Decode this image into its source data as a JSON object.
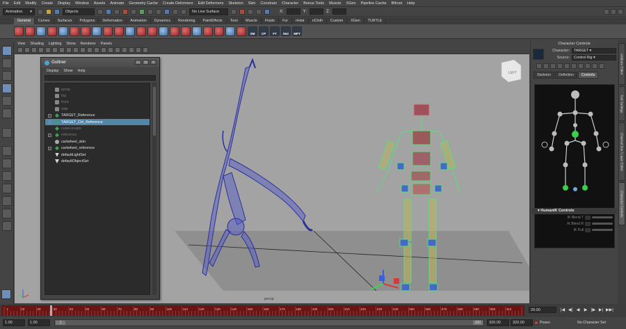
{
  "menubar": [
    "File",
    "Edit",
    "Modify",
    "Create",
    "Display",
    "Window",
    "Assets",
    "Animate",
    "Geometry Cache",
    "Create Deformers",
    "Edit Deformers",
    "Skeleton",
    "Skin",
    "Constrain",
    "Character",
    "Bonus Tools",
    "Muscle",
    "XGen",
    "Pipeline Cache",
    "Bifrost",
    "Help"
  ],
  "status_line": {
    "menu_set": "Animation",
    "selection_mode": "Objects",
    "live_surface": "No Live Surface",
    "x_label": "X:",
    "y_label": "Y:",
    "z_label": "Z:"
  },
  "shelf_tabs": [
    "General",
    "Curves",
    "Surfaces",
    "Polygons",
    "Deformation",
    "Animation",
    "Dynamics",
    "Rendering",
    "PaintEffects",
    "Toon",
    "Muscle",
    "Fluids",
    "Fur",
    "nHair",
    "nCloth",
    "Custom",
    "XGen",
    "TURTLE"
  ],
  "shelf_active_tab": "General",
  "shelf_labels": [
    "SM",
    "CP",
    "FT",
    "Mst",
    "MPT"
  ],
  "viewport": {
    "menu": [
      "View",
      "Shading",
      "Lighting",
      "Show",
      "Renderer",
      "Panels"
    ],
    "camera_label": "persp",
    "view_cube_label": "LEFT"
  },
  "outliner": {
    "title": "Outliner",
    "menu": [
      "Display",
      "Show",
      "Help"
    ],
    "items": [
      {
        "label": "persp",
        "icon": "camera-icon",
        "dim": true,
        "expand": false,
        "selected": false
      },
      {
        "label": "top",
        "icon": "camera-icon",
        "dim": true,
        "expand": false,
        "selected": false
      },
      {
        "label": "front",
        "icon": "camera-icon",
        "dim": true,
        "expand": false,
        "selected": false
      },
      {
        "label": "side",
        "icon": "camera-icon",
        "dim": true,
        "expand": false,
        "selected": false
      },
      {
        "label": "TARGET_Reference",
        "icon": "joint-icon",
        "dim": false,
        "expand": true,
        "selected": false
      },
      {
        "label": "TARGET_Ctrl_Reference",
        "icon": "joint-icon",
        "dim": false,
        "expand": true,
        "selected": true
      },
      {
        "label": "cubeLocator",
        "icon": "joint-icon",
        "dim": true,
        "expand": false,
        "selected": false
      },
      {
        "label": "reference",
        "icon": "joint-icon",
        "dim": true,
        "expand": true,
        "selected": false
      },
      {
        "label": "cartwheel_skin",
        "icon": "mesh-icon",
        "dim": false,
        "expand": false,
        "selected": false
      },
      {
        "label": "cartwheel_reference",
        "icon": "joint-icon",
        "dim": false,
        "expand": true,
        "selected": false
      },
      {
        "label": "defaultLightSet",
        "icon": "set-icon",
        "dim": false,
        "expand": false,
        "selected": false
      },
      {
        "label": "defaultObjectSet",
        "icon": "set-icon",
        "dim": false,
        "expand": false,
        "selected": false
      }
    ]
  },
  "character_controls": {
    "title": "Character Controls",
    "character_label": "Character:",
    "character_value": "TARGET",
    "source_label": "Source:",
    "source_value": "Control Rig",
    "tabs": [
      "Skeleton",
      "Definition",
      "Controls"
    ],
    "active_tab": "Controls",
    "section_title": "HumanIK Controls",
    "controls": [
      "IK Blend T",
      "IK Blend R",
      "IK Pull"
    ]
  },
  "side_tabs": [
    "Attribute Editor",
    "Tool Settings",
    "Channel Box / Layer Editor",
    "Character Controls"
  ],
  "side_tabs_active": "Character Controls",
  "timeline": {
    "ticks": [
      "1",
      "10",
      "20",
      "30",
      "40",
      "50",
      "60",
      "70",
      "80",
      "90",
      "100",
      "110",
      "120",
      "130",
      "140",
      "150",
      "160",
      "170",
      "180",
      "190",
      "200",
      "210",
      "220",
      "230",
      "240",
      "250",
      "260",
      "270",
      "280",
      "290",
      "300",
      "310"
    ],
    "current_frame": "29.00",
    "playback_buttons": [
      "|◀",
      "◀|",
      "◀",
      "▶",
      "|▶",
      "▶|",
      "▶▶|"
    ]
  },
  "range": {
    "start": "1.00",
    "inner_start": "1.00",
    "inner_start_knob": "1",
    "end_knob": "320",
    "inner_end": "320.00",
    "end": "320.00",
    "poses_label": "Poses",
    "character_set": "No Character Set"
  },
  "colors": {
    "viewport_bg": "#a3a3a3",
    "timeline_red": "#6b1414",
    "selection_blue": "#5285a6",
    "wireframe": "#2b2f9c",
    "rig_green": "#55e07a"
  }
}
